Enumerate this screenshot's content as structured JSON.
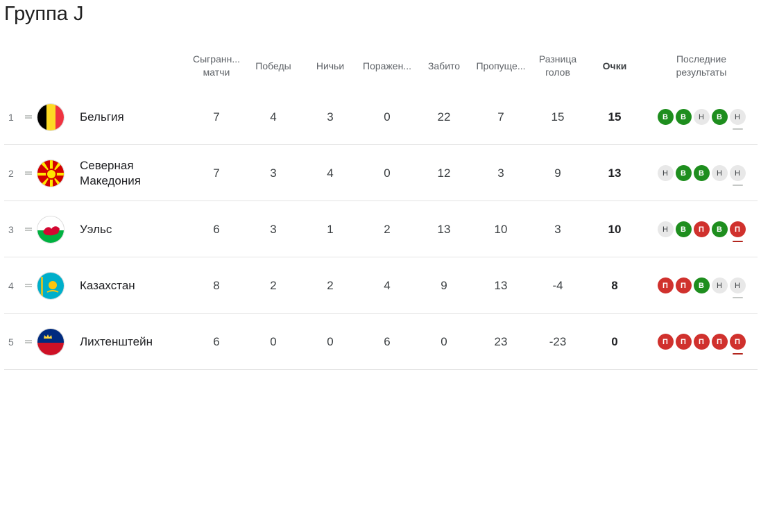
{
  "title": "Группа J",
  "headers": {
    "played": "Сыгранн...",
    "played2": "матчи",
    "wins": "Победы",
    "draws": "Ничьи",
    "losses": "Поражен...",
    "gf": "Забито",
    "ga": "Пропуще...",
    "gd1": "Разница",
    "gd2": "голов",
    "pts": "Очки",
    "last1": "Последние",
    "last2": "результаты"
  },
  "colors": {
    "win": "#1e8e1e",
    "draw": "#e8e8e8",
    "loss": "#d0312d"
  },
  "rows": [
    {
      "pos": "1",
      "team": "Бельгия",
      "flag": "belgium-flag-icon",
      "mp": "7",
      "w": "4",
      "d": "3",
      "l": "0",
      "gf": "22",
      "ga": "7",
      "gd": "15",
      "pts": "15",
      "results": [
        {
          "t": "В",
          "k": "win"
        },
        {
          "t": "В",
          "k": "win"
        },
        {
          "t": "Н",
          "k": "draw"
        },
        {
          "t": "В",
          "k": "win"
        },
        {
          "t": "Н",
          "k": "draw"
        }
      ]
    },
    {
      "pos": "2",
      "team": "Северная Македония",
      "flag": "north-macedonia-flag-icon",
      "mp": "7",
      "w": "3",
      "d": "4",
      "l": "0",
      "gf": "12",
      "ga": "3",
      "gd": "9",
      "pts": "13",
      "results": [
        {
          "t": "Н",
          "k": "draw"
        },
        {
          "t": "В",
          "k": "win"
        },
        {
          "t": "В",
          "k": "win"
        },
        {
          "t": "Н",
          "k": "draw"
        },
        {
          "t": "Н",
          "k": "draw"
        }
      ]
    },
    {
      "pos": "3",
      "team": "Уэльс",
      "flag": "wales-flag-icon",
      "mp": "6",
      "w": "3",
      "d": "1",
      "l": "2",
      "gf": "13",
      "ga": "10",
      "gd": "3",
      "pts": "10",
      "results": [
        {
          "t": "Н",
          "k": "draw"
        },
        {
          "t": "В",
          "k": "win"
        },
        {
          "t": "П",
          "k": "loss"
        },
        {
          "t": "В",
          "k": "win"
        },
        {
          "t": "П",
          "k": "loss"
        }
      ]
    },
    {
      "pos": "4",
      "team": "Казахстан",
      "flag": "kazakhstan-flag-icon",
      "mp": "8",
      "w": "2",
      "d": "2",
      "l": "4",
      "gf": "9",
      "ga": "13",
      "gd": "-4",
      "pts": "8",
      "results": [
        {
          "t": "П",
          "k": "loss"
        },
        {
          "t": "П",
          "k": "loss"
        },
        {
          "t": "В",
          "k": "win"
        },
        {
          "t": "Н",
          "k": "draw"
        },
        {
          "t": "Н",
          "k": "draw"
        }
      ]
    },
    {
      "pos": "5",
      "team": "Лихтенштейн",
      "flag": "liechtenstein-flag-icon",
      "mp": "6",
      "w": "0",
      "d": "0",
      "l": "6",
      "gf": "0",
      "ga": "23",
      "gd": "-23",
      "pts": "0",
      "results": [
        {
          "t": "П",
          "k": "loss"
        },
        {
          "t": "П",
          "k": "loss"
        },
        {
          "t": "П",
          "k": "loss"
        },
        {
          "t": "П",
          "k": "loss"
        },
        {
          "t": "П",
          "k": "loss"
        }
      ]
    }
  ]
}
